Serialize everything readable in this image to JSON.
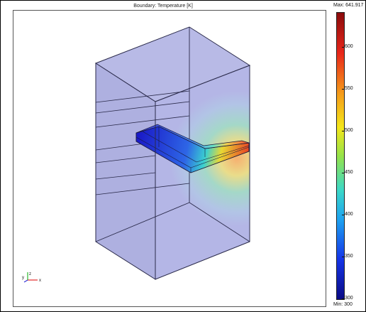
{
  "plot": {
    "title": "Boundary: Temperature [K]"
  },
  "colorbar": {
    "max_label": "Max: 641.917",
    "min_label": "Min: 300",
    "ticks": [
      "600",
      "550",
      "500",
      "450",
      "400",
      "350",
      "300"
    ],
    "colors": [
      "#0a0a84",
      "#1535e8",
      "#1ea4f0",
      "#3bd8c8",
      "#96e34a",
      "#f4e61a",
      "#f59a1a",
      "#e8261a",
      "#8a0b0b"
    ]
  },
  "axes": {
    "x": "x",
    "y": "y",
    "z": "z"
  },
  "colors": {
    "box_fill": "#b4b6e6",
    "hot_spot": "#f2a860",
    "edge": "#2a2a4a"
  }
}
